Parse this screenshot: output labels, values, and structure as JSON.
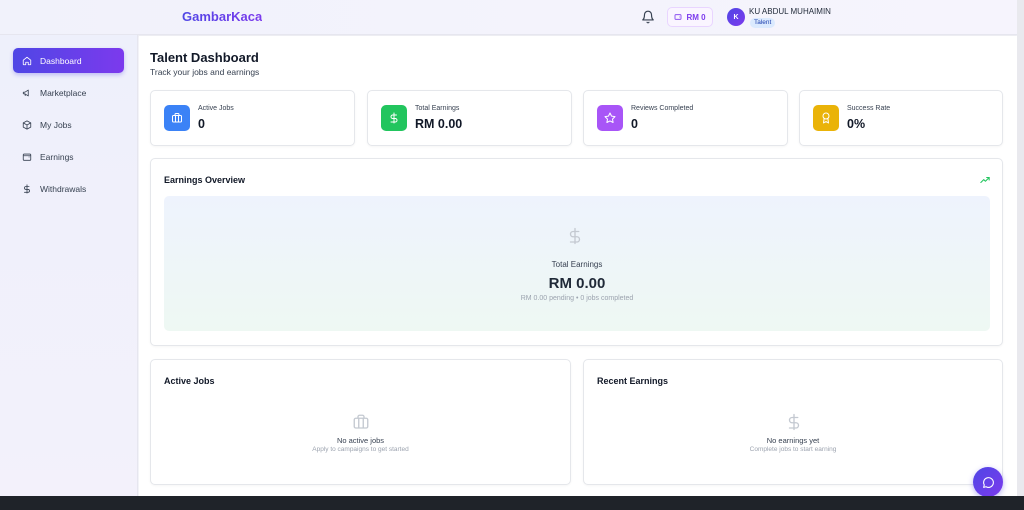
{
  "header": {
    "brand": "GambarKaca",
    "wallet_balance": "RM 0",
    "user": {
      "initial": "K",
      "name": "KU ABDUL MUHAIMIN",
      "role": "Talent"
    }
  },
  "sidebar": {
    "items": [
      {
        "label": "Dashboard",
        "icon": "home-icon",
        "active": true
      },
      {
        "label": "Marketplace",
        "icon": "megaphone-icon",
        "active": false
      },
      {
        "label": "My Jobs",
        "icon": "box-icon",
        "active": false
      },
      {
        "label": "Earnings",
        "icon": "wallet-icon",
        "active": false
      },
      {
        "label": "Withdrawals",
        "icon": "dollar-icon",
        "active": false
      }
    ]
  },
  "page": {
    "title": "Talent Dashboard",
    "subtitle": "Track your jobs and earnings"
  },
  "stats": [
    {
      "label": "Active Jobs",
      "value": "0",
      "icon": "briefcase-icon",
      "color": "#3b82f6"
    },
    {
      "label": "Total Earnings",
      "value": "RM 0.00",
      "icon": "dollar-icon",
      "color": "#22c55e"
    },
    {
      "label": "Reviews Completed",
      "value": "0",
      "icon": "star-icon",
      "color": "#a855f7"
    },
    {
      "label": "Success Rate",
      "value": "0%",
      "icon": "award-icon",
      "color": "#eab308"
    }
  ],
  "earnings_overview": {
    "title": "Earnings Overview",
    "total_label": "Total Earnings",
    "total_value": "RM 0.00",
    "summary": "RM 0.00 pending • 0 jobs completed",
    "trend_color": "#22c55e"
  },
  "active_jobs": {
    "title": "Active Jobs",
    "empty_title": "No active jobs",
    "empty_sub": "Apply to campaigns to get started"
  },
  "recent_earnings": {
    "title": "Recent Earnings",
    "empty_title": "No earnings yet",
    "empty_sub": "Complete jobs to start earning"
  },
  "colors": {
    "accent": "#4f46e5",
    "accent_2": "#7c3aed"
  }
}
